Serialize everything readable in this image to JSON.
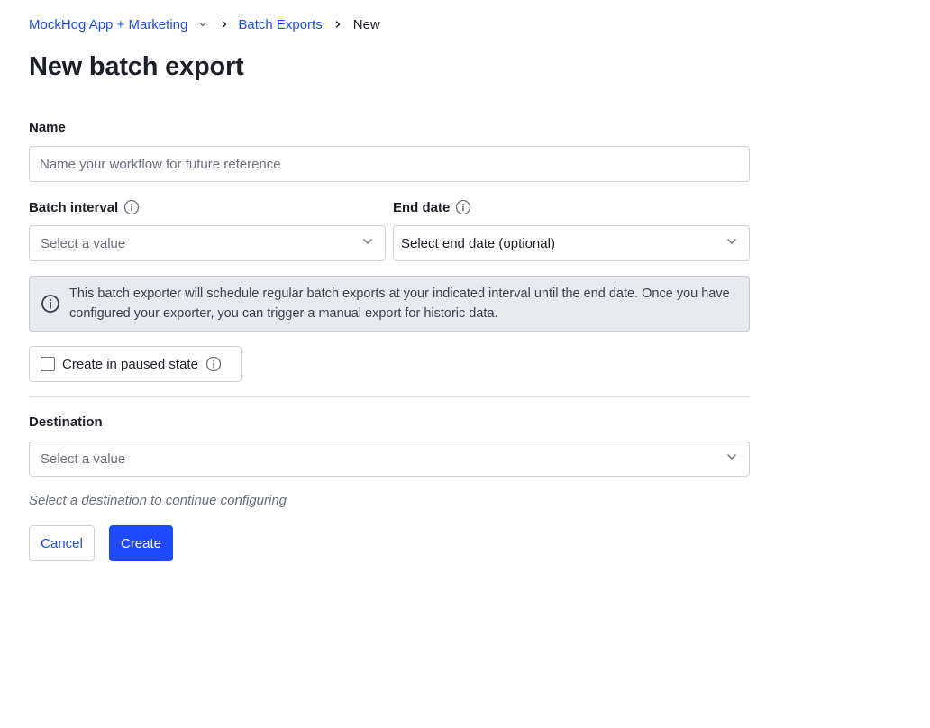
{
  "breadcrumb": {
    "project": "MockHog App + Marketing",
    "section": "Batch Exports",
    "current": "New"
  },
  "page": {
    "title": "New batch export"
  },
  "form": {
    "name": {
      "label": "Name",
      "placeholder": "Name your workflow for future reference",
      "value": ""
    },
    "batch_interval": {
      "label": "Batch interval",
      "placeholder": "Select a value"
    },
    "end_date": {
      "label": "End date",
      "value": "Select end date (optional)"
    },
    "info_banner": "This batch exporter will schedule regular batch exports at your indicated interval until the end date. Once you have configured your exporter, you can trigger a manual export for historic data.",
    "paused": {
      "label": "Create in paused state",
      "checked": false
    },
    "destination": {
      "label": "Destination",
      "placeholder": "Select a value",
      "hint": "Select a destination to continue configuring"
    }
  },
  "actions": {
    "cancel": "Cancel",
    "create": "Create"
  },
  "colors": {
    "accent": "#1d4aff",
    "banner_bg": "#e9eaee",
    "text": "#1d1f27",
    "muted": "#6b6f7b"
  }
}
